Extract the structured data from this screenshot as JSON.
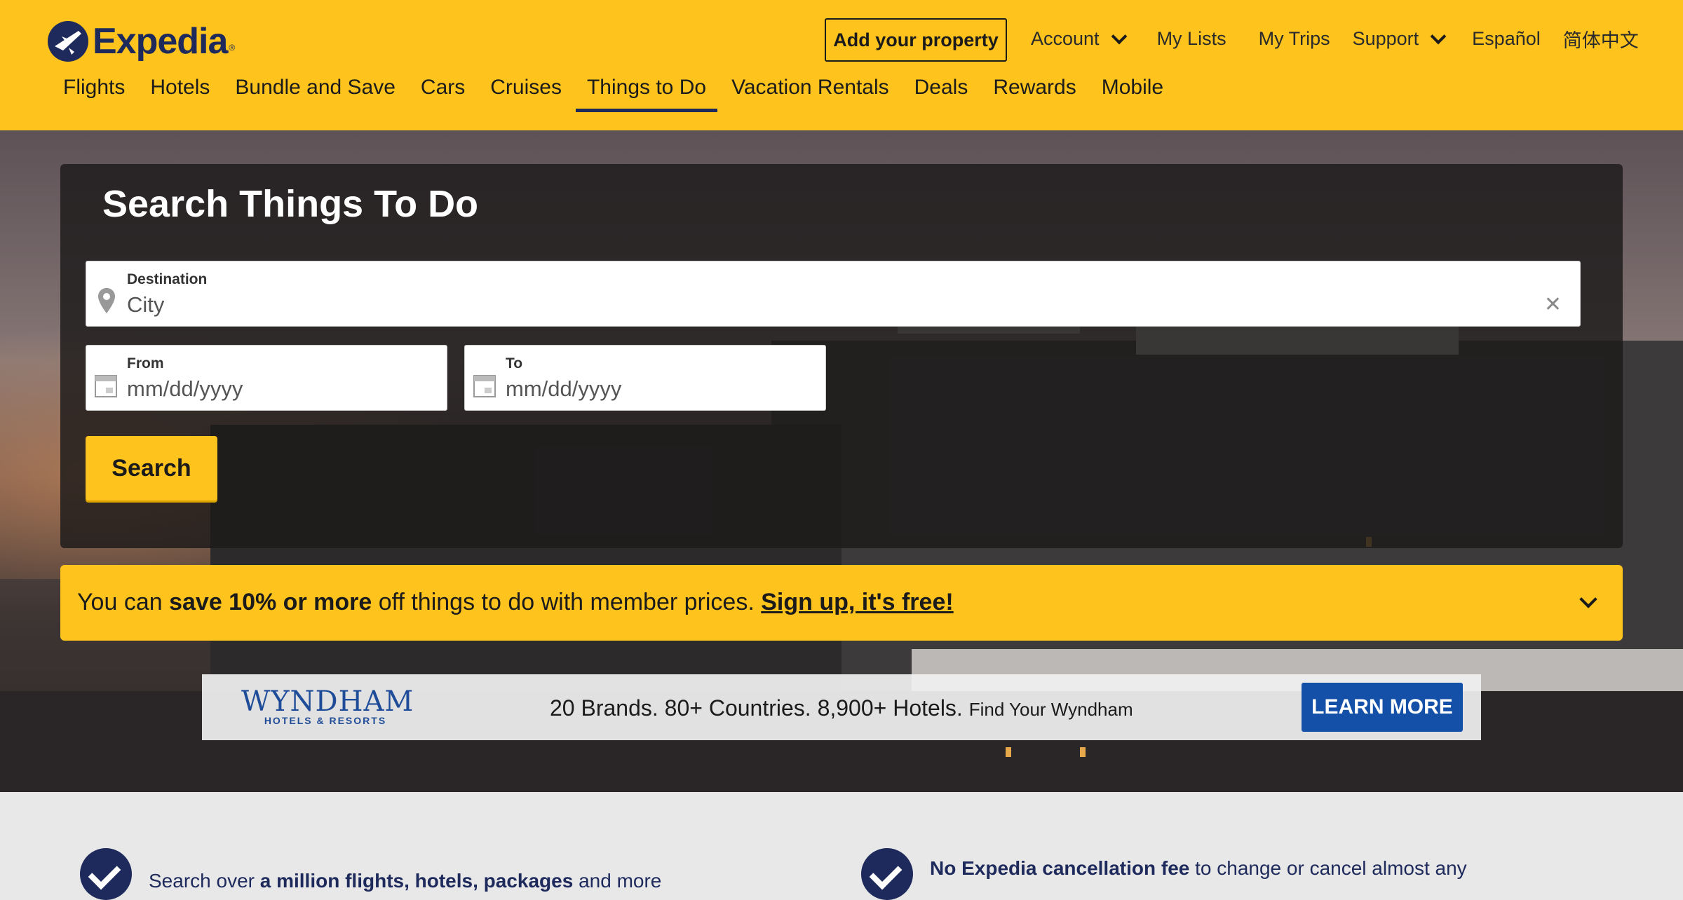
{
  "header": {
    "logo_text": "Expedia",
    "logo_tm": "®",
    "add_property": "Add your property",
    "top_links": [
      {
        "label": "Account",
        "dropdown": true
      },
      {
        "label": "My Lists",
        "dropdown": false
      },
      {
        "label": "My Trips",
        "dropdown": false
      },
      {
        "label": "Support",
        "dropdown": true
      },
      {
        "label": "Español",
        "dropdown": false
      },
      {
        "label": "简体中文",
        "dropdown": false
      }
    ],
    "nav": [
      "Flights",
      "Hotels",
      "Bundle and Save",
      "Cars",
      "Cruises",
      "Things to Do",
      "Vacation Rentals",
      "Deals",
      "Rewards",
      "Mobile"
    ],
    "active_nav": "Things to Do"
  },
  "search": {
    "title": "Search Things To Do",
    "destination_label": "Destination",
    "destination_placeholder": "City",
    "from_label": "From",
    "from_placeholder": "mm/dd/yyyy",
    "to_label": "To",
    "to_placeholder": "mm/dd/yyyy",
    "button": "Search"
  },
  "promo": {
    "prefix": "You can ",
    "bold": "save 10% or more",
    "middle": " off things to do with member prices. ",
    "link": "Sign up, it's free!"
  },
  "ad": {
    "brand": "WYNDHAM",
    "brand_sub": "HOTELS & RESORTS",
    "headline": "20 Brands. 80+ Countries. 8,900+ Hotels.",
    "tagline": "Find Your Wyndham",
    "button": "LEARN MORE"
  },
  "features": [
    {
      "pre": "Search over ",
      "bold": "a million flights, hotels, packages",
      "post": " and more"
    },
    {
      "pre": "",
      "bold": "No Expedia cancellation fee",
      "post": " to change or cancel almost any"
    }
  ],
  "colors": {
    "brand_yellow": "#fec31c",
    "brand_navy": "#1e2a5c",
    "ad_blue": "#1450a8"
  }
}
